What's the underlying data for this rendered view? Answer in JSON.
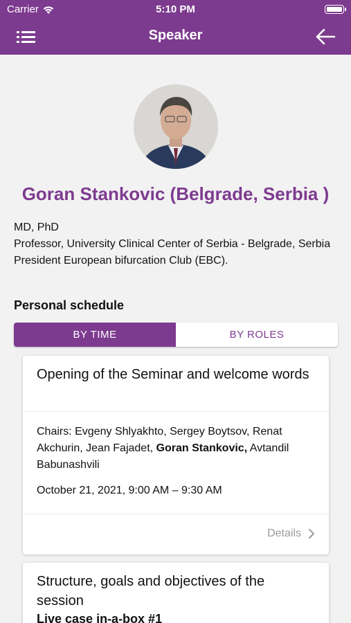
{
  "status_bar": {
    "carrier": "Carrier",
    "time": "5:10 PM"
  },
  "nav": {
    "title": "Speaker"
  },
  "speaker": {
    "name": "Goran Stankovic (Belgrade, Serbia )",
    "bio_line1": "MD, PhD",
    "bio_line2": "Professor, University Clinical Center of Serbia - Belgrade, Serbia President European bifurcation Club (EBC)."
  },
  "schedule": {
    "title": "Personal schedule",
    "tabs": [
      {
        "label": "BY TIME",
        "active": true
      },
      {
        "label": "BY ROLES",
        "active": false
      }
    ],
    "cards": [
      {
        "title": "Opening of the Seminar and welcome words",
        "chairs_prefix": "Chairs: Evgeny Shlyakhto, Sergey Boytsov, Renat Akchurin, Jean Fajadet, ",
        "chairs_highlight": "Goran Stankovic,",
        "chairs_suffix": " Avtandil Babunashvili",
        "datetime": "October 21, 2021, 9:00 AM – 9:30 AM",
        "details_label": "Details"
      },
      {
        "title": "Structure, goals and objectives of the session",
        "subtitle": "Live case in-a-box #1"
      }
    ]
  },
  "colors": {
    "primary": "#7d3b8f",
    "background": "#f3f2f3"
  }
}
